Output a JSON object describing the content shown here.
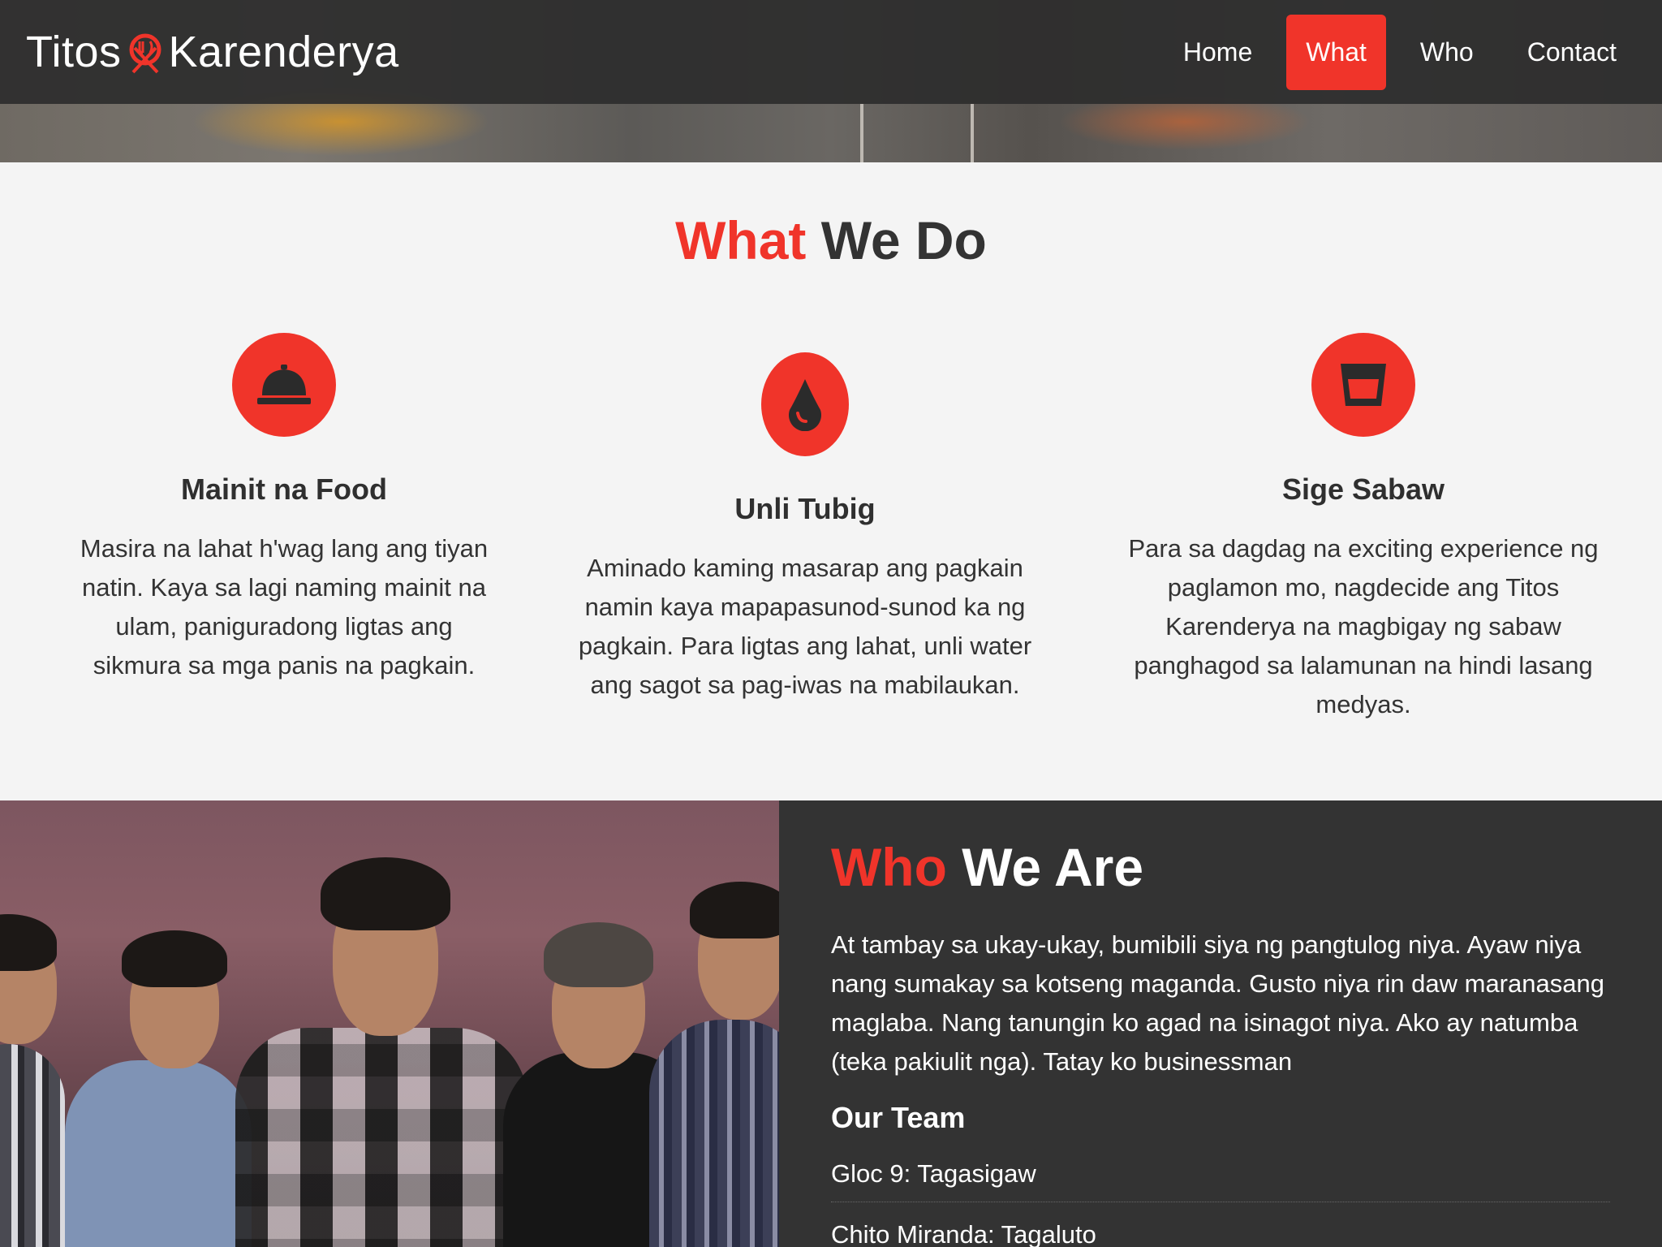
{
  "brand": {
    "name_part1": "Titos",
    "name_part2": "Karenderya",
    "logo_icon": "fork-knife-icon"
  },
  "nav": {
    "items": [
      {
        "label": "Home",
        "active": false
      },
      {
        "label": "What",
        "active": true
      },
      {
        "label": "Who",
        "active": false
      },
      {
        "label": "Contact",
        "active": false
      }
    ]
  },
  "what_section": {
    "title_accent": "What",
    "title_rest": "We Do",
    "features": [
      {
        "icon": "bell-icon",
        "title": "Mainit na Food",
        "text": "Masira na lahat h'wag lang ang tiyan natin. Kaya sa lagi naming mainit na ulam, paniguradong ligtas ang sikmura sa mga panis na pagkain."
      },
      {
        "icon": "drop-icon",
        "title": "Unli Tubig",
        "text": "Aminado kaming masarap ang pagkain namin kaya mapapasunod-sunod ka ng pagkain. Para ligtas ang lahat, unli water ang sagot sa pag-iwas na mabilaukan."
      },
      {
        "icon": "glass-icon",
        "title": "Sige Sabaw",
        "text": "Para sa dagdag na exciting experience ng paglamon mo, nagdecide ang Titos Karenderya na magbigay ng sabaw panghagod sa lalamunan na hindi lasang medyas."
      }
    ]
  },
  "who_section": {
    "title_accent": "Who",
    "title_rest": "We Are",
    "text": "At tambay sa ukay-ukay, bumibili siya ng pangtulog niya. Ayaw niya nang sumakay sa kotseng maganda. Gusto niya rin daw maranasang maglaba. Nang tanungin ko agad na isinagot niya. Ako ay natumba (teka pakiulit nga). Tatay ko businessman",
    "team_title": "Our Team",
    "team": [
      {
        "entry": "Gloc 9: Tagasigaw"
      },
      {
        "entry": "Chito Miranda: Tagaluto"
      }
    ]
  },
  "colors": {
    "accent": "#f0342a",
    "dark": "#333333",
    "navbar": "#2c2c2c",
    "background": "#f4f4f4"
  }
}
